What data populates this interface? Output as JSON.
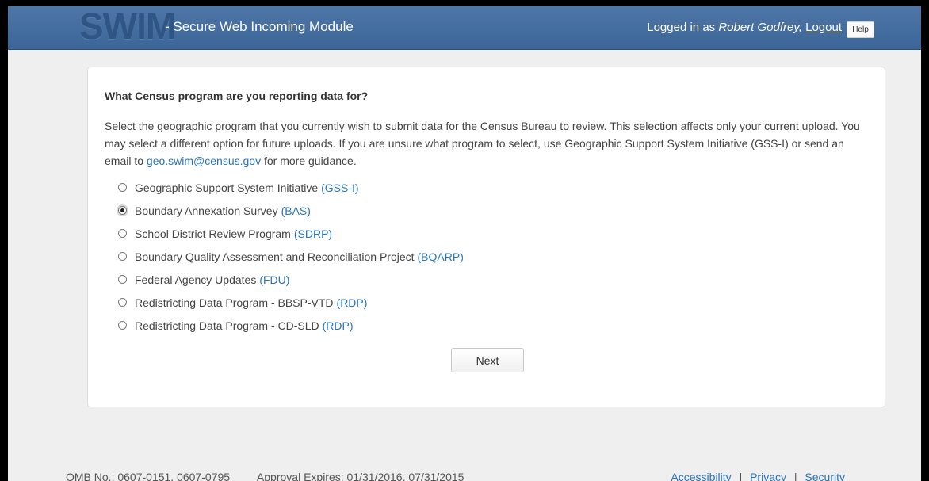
{
  "header": {
    "logo": "SWIM",
    "title": "- Secure Web Incoming Module",
    "logged_in_prefix": "Logged in as",
    "user_name": "Robert Godfrey,",
    "logout_label": "Logout",
    "help_label": "Help"
  },
  "main": {
    "question": "What Census program are you reporting data for?",
    "intro_text": "Select the geographic program that you currently wish to submit data for the Census Bureau to review. This selection affects only your current upload. You may select a different option for future uploads. If you are unsure what program to select, use Geographic Support System Initiative (GSS-I) or send an email to",
    "email": "geo.swim@census.gov",
    "intro_suffix": "for more guidance.",
    "options": [
      {
        "label": "Geographic Support System Initiative",
        "abbr": "(GSS-I)",
        "selected": false
      },
      {
        "label": "Boundary Annexation Survey",
        "abbr": "(BAS)",
        "selected": true
      },
      {
        "label": "School District Review Program",
        "abbr": "(SDRP)",
        "selected": false
      },
      {
        "label": "Boundary Quality Assessment and Reconciliation Project",
        "abbr": "(BQARP)",
        "selected": false
      },
      {
        "label": "Federal Agency Updates",
        "abbr": "(FDU)",
        "selected": false
      },
      {
        "label": "Redistricting Data Program - BBSP-VTD",
        "abbr": "(RDP)",
        "selected": false
      },
      {
        "label": "Redistricting Data Program - CD-SLD",
        "abbr": "(RDP)",
        "selected": false
      }
    ],
    "next_label": "Next"
  },
  "footer": {
    "omb": "OMB No.: 0607-0151, 0607-0795",
    "approval": "Approval Expires: 01/31/2016, 07/31/2015",
    "links": [
      "Accessibility",
      "Privacy",
      "Security"
    ],
    "separator": "|"
  },
  "colors": {
    "header_bg": "#3f6a9d",
    "link": "#2a74b8",
    "page_bg": "#efefef"
  }
}
